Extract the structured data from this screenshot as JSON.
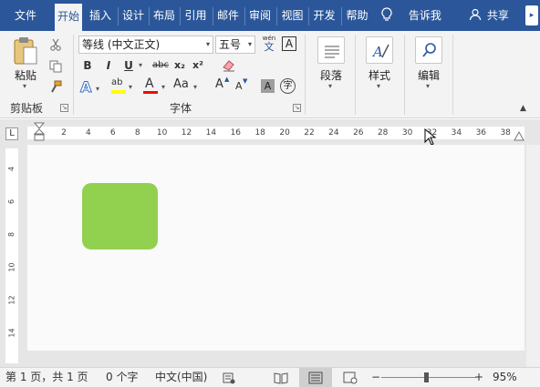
{
  "tabs": [
    {
      "label": "文件",
      "active": false
    },
    {
      "label": "开始",
      "active": true
    },
    {
      "label": "插入",
      "active": false
    },
    {
      "label": "设计",
      "active": false
    },
    {
      "label": "布局",
      "active": false
    },
    {
      "label": "引用",
      "active": false
    },
    {
      "label": "邮件",
      "active": false
    },
    {
      "label": "审阅",
      "active": false
    },
    {
      "label": "视图",
      "active": false
    },
    {
      "label": "开发",
      "active": false
    },
    {
      "label": "帮助",
      "active": false
    }
  ],
  "tell_me": {
    "label": "告诉我",
    "icon": "lightbulb-icon"
  },
  "share": {
    "label": "共享",
    "icon": "person-icon"
  },
  "ribbon": {
    "clipboard": {
      "group_label": "剪贴板",
      "paste_label": "粘贴",
      "cut_icon": "scissors-icon",
      "copy_icon": "copy-icon",
      "format_painter_icon": "format-painter-icon"
    },
    "font": {
      "group_label": "字体",
      "font_name": "等线 (中文正文)",
      "font_size": "五号",
      "pinyin_label": "wén",
      "pinyin_char": "文",
      "border_char": "A",
      "bold": "B",
      "italic": "I",
      "underline": "U",
      "strike": "abc",
      "subscript": "x₂",
      "superscript": "x²",
      "text_effect": "A",
      "highlight": "ab",
      "font_color": "A",
      "change_case": "Aa",
      "grow_font": "A",
      "shrink_font": "A",
      "char_shading": "A",
      "enclose_char": "字"
    },
    "paragraph": {
      "label": "段落"
    },
    "styles": {
      "label": "样式"
    },
    "editing": {
      "label": "编辑"
    }
  },
  "ruler": {
    "tab_selector": "L",
    "numbers": [
      "2",
      "4",
      "6",
      "8",
      "10",
      "12",
      "14",
      "16",
      "18",
      "20",
      "22",
      "24",
      "26",
      "28",
      "30",
      "32",
      "34",
      "36",
      "38"
    ],
    "vertical_numbers": [
      "4",
      "6",
      "8",
      "10",
      "12",
      "14"
    ]
  },
  "document": {
    "shape_color": "#92d050"
  },
  "status": {
    "page_info": "第 1 页，共 1 页",
    "word_count": "0 个字",
    "language": "中文(中国)",
    "zoom": "95%",
    "zoom_minus": "−",
    "zoom_plus": "+"
  },
  "colors": {
    "accent": "#2b579a",
    "highlight_yellow": "#ffff00",
    "font_red": "#ff0000"
  }
}
